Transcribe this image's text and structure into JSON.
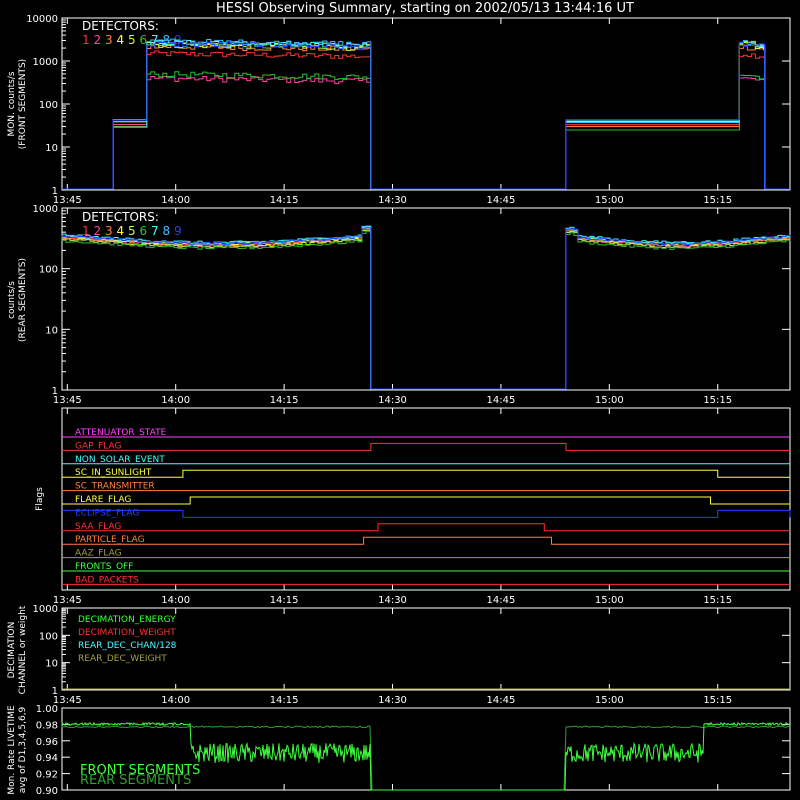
{
  "title": "HESSI Observing Summary, starting on 2002/05/13 13:44:16 UT",
  "colors": {
    "d1": "#ff3030",
    "d2": "#ff40a0",
    "d3": "#ff8040",
    "d4": "#ffff40",
    "d5": "#c0ff40",
    "d6": "#30c030",
    "d7": "#40ffff",
    "d8": "#40c0ff",
    "d9": "#2040ff",
    "frame": "#ffffff"
  },
  "x_ticks": [
    "13:45",
    "14:00",
    "14:15",
    "14:30",
    "14:45",
    "15:00",
    "15:15"
  ],
  "detectors_label": "DETECTORS:",
  "detector_numbers": [
    "1",
    "2",
    "3",
    "4",
    "5",
    "6",
    "7",
    "8",
    "9"
  ],
  "chart_data": [
    {
      "type": "line",
      "panel": "front",
      "ylabel_line1": "MON. counts/s",
      "ylabel_line2": "(FRONT SEGMENTS)",
      "yscale": "log",
      "ylim": [
        1,
        10000
      ],
      "yticks": [
        "1",
        "10",
        "100",
        "1000",
        "10000"
      ],
      "xlim": [
        "13:44:16",
        "15:25"
      ],
      "segments": [
        {
          "start": "13:51:20",
          "step1_end": "13:56",
          "level1": 35,
          "end": "14:27"
        },
        {
          "start": "14:54",
          "step1_end": "15:18",
          "level1": 35,
          "end": "15:21:30"
        }
      ],
      "series": [
        {
          "name": "1",
          "level": 1500
        },
        {
          "name": "2",
          "level": 400
        },
        {
          "name": "3",
          "level": 2200
        },
        {
          "name": "4",
          "level": 2600
        },
        {
          "name": "5",
          "level": 2400
        },
        {
          "name": "6",
          "level": 500
        },
        {
          "name": "7",
          "level": 2700
        },
        {
          "name": "8",
          "level": 2900
        },
        {
          "name": "9",
          "level": 2500
        }
      ]
    },
    {
      "type": "line",
      "panel": "rear",
      "ylabel_line1": "counts/s",
      "ylabel_line2": "(REAR SEGMENTS)",
      "yscale": "log",
      "ylim": [
        1,
        1000
      ],
      "yticks": [
        "1",
        "10",
        "100",
        "1000"
      ],
      "xlim": [
        "13:44:16",
        "15:25"
      ],
      "segments": [
        {
          "start": "13:44:16",
          "end": "14:27"
        },
        {
          "start": "14:54",
          "end": "15:25"
        }
      ],
      "series": [
        {
          "name": "1",
          "level": 330
        },
        {
          "name": "2",
          "level": 320
        },
        {
          "name": "3",
          "level": 330
        },
        {
          "name": "4",
          "level": 340
        },
        {
          "name": "5",
          "level": 310
        },
        {
          "name": "6",
          "level": 290
        },
        {
          "name": "7",
          "level": 360
        },
        {
          "name": "8",
          "level": 350
        },
        {
          "name": "9",
          "level": 345
        }
      ]
    },
    {
      "type": "line",
      "panel": "flags",
      "ylabel": "Flags",
      "flags": [
        {
          "name": "ATTENUATOR_STATE",
          "color": "#ff40ff",
          "on": []
        },
        {
          "name": "GAP_FLAG",
          "color": "#ff3030",
          "on": [
            [
              "14:27",
              "14:54"
            ]
          ]
        },
        {
          "name": "NON_SOLAR_EVENT",
          "color": "#40ffff",
          "on": []
        },
        {
          "name": "SC_IN_SUNLIGHT",
          "color": "#ffff40",
          "on": [
            [
              "14:01",
              "15:15"
            ]
          ]
        },
        {
          "name": "SC_TRANSMITTER",
          "color": "#ff8040",
          "on": []
        },
        {
          "name": "FLARE_FLAG",
          "color": "#ffff40",
          "on": [
            [
              "14:02",
              "15:14"
            ]
          ]
        },
        {
          "name": "ECLIPSE_FLAG",
          "color": "#2040ff",
          "on": [
            [
              "13:44:16",
              "14:01"
            ],
            [
              "15:15",
              "15:25"
            ]
          ]
        },
        {
          "name": "SAA_FLAG",
          "color": "#ff3030",
          "on": [
            [
              "14:28",
              "14:51"
            ]
          ]
        },
        {
          "name": "PARTICLE_FLAG",
          "color": "#ff8040",
          "on": [
            [
              "14:26",
              "14:52"
            ]
          ]
        },
        {
          "name": "AAZ_FLAG",
          "color": "#a0a040",
          "on": []
        },
        {
          "name": "FRONTS_OFF",
          "color": "#40ff40",
          "on": []
        },
        {
          "name": "BAD_PACKETS",
          "color": "#ff3030",
          "on": []
        }
      ]
    },
    {
      "type": "line",
      "panel": "decimation",
      "ylabel_line1": "DECIMATION",
      "ylabel_line2": "CHANNEL or weight",
      "yscale": "log",
      "ylim": [
        1,
        1000
      ],
      "yticks": [
        "1",
        "10",
        "100",
        "1000"
      ],
      "legend": [
        {
          "name": "DECIMATION_ENERGY",
          "color": "#40ff40"
        },
        {
          "name": "DECIMATION_WEIGHT",
          "color": "#ff3030"
        },
        {
          "name": "REAR_DEC_CHAN/128",
          "color": "#40ffff"
        },
        {
          "name": "REAR_DEC_WEIGHT",
          "color": "#a0a040"
        }
      ]
    },
    {
      "type": "line",
      "panel": "livetime",
      "ylabel_line1": "Mon. Rate LIVETIME",
      "ylabel_line2": "avg of D1,3,4,5,6,9",
      "ylim": [
        0.9,
        1.0
      ],
      "yticks": [
        "0.90",
        "0.92",
        "0.94",
        "0.96",
        "0.98",
        "1.00"
      ],
      "legend": [
        {
          "name": "FRONT SEGMENTS",
          "color": "#40ff40"
        },
        {
          "name": "REAR SEGMENTS",
          "color": "#30a030"
        }
      ],
      "front_levels": {
        "low": 0.982,
        "active": 0.945
      },
      "rear_level": 0.978
    }
  ]
}
